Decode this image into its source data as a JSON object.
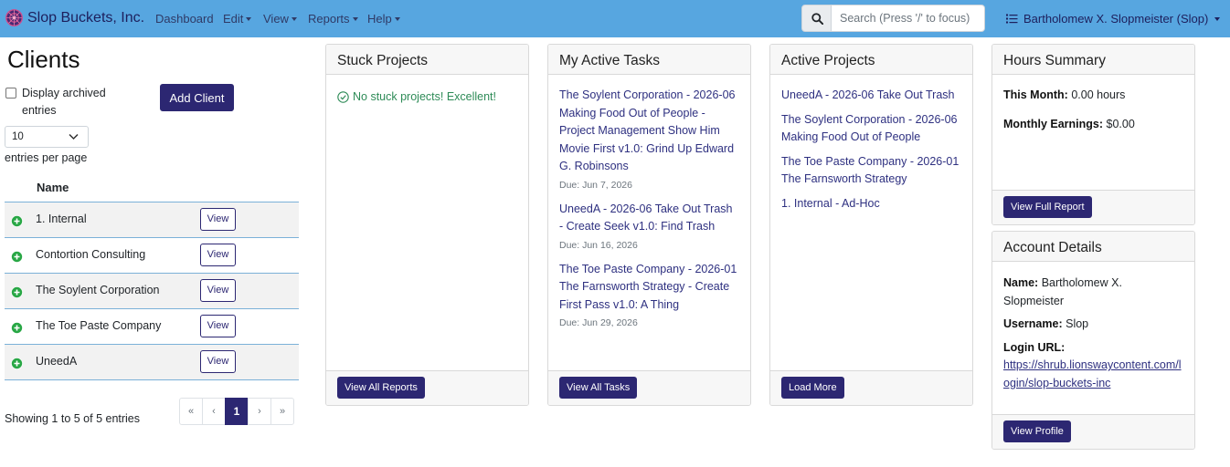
{
  "navbar": {
    "brand": "Slop Buckets, Inc.",
    "menu": {
      "dashboard": "Dashboard",
      "edit": "Edit",
      "view": "View",
      "reports": "Reports",
      "help": "Help"
    },
    "search": {
      "placeholder": "Search (Press '/' to focus)",
      "value": ""
    },
    "user": "Bartholomew X. Slopmeister (Slop)",
    "color": "#57a6e0"
  },
  "clients": {
    "title": "Clients",
    "archived_label": "Display archived entries",
    "add_button": "Add Client",
    "per_page_value": "10",
    "per_page_label": "entries per page",
    "column_name": "Name",
    "view_label": "View",
    "rows": [
      {
        "name": "1. Internal"
      },
      {
        "name": "Contortion Consulting"
      },
      {
        "name": "The Soylent Corporation"
      },
      {
        "name": "The Toe Paste Company"
      },
      {
        "name": "UneedA"
      }
    ],
    "showing": "Showing 1 to 5 of 5 entries",
    "pager": {
      "first": "«",
      "prev": "‹",
      "current": "1",
      "next": "›",
      "last": "»"
    }
  },
  "stuck_projects": {
    "title": "Stuck Projects",
    "message": "No stuck projects! Excellent!",
    "footer_button": "View All Reports"
  },
  "active_tasks": {
    "title": "My Active Tasks",
    "tasks": [
      {
        "text": "The Soylent Corporation - 2026-06 Making Food Out of People - Project Management Show Him Movie First v1.0: Grind Up Edward G. Robinsons",
        "due": "Due: Jun 7, 2026"
      },
      {
        "text": "UneedA - 2026-06 Take Out Trash - Create Seek v1.0: Find Trash",
        "due": "Due: Jun 16, 2026"
      },
      {
        "text": "The Toe Paste Company - 2026-01 The Farnsworth Strategy - Create First Pass v1.0: A Thing",
        "due": "Due: Jun 29, 2026"
      }
    ],
    "footer_button": "View All Tasks"
  },
  "active_projects": {
    "title": "Active Projects",
    "projects": [
      "UneedA - 2026-06 Take Out Trash",
      "The Soylent Corporation - 2026-06 Making Food Out of People",
      "The Toe Paste Company - 2026-01 The Farnsworth Strategy",
      "1. Internal - Ad-Hoc"
    ],
    "footer_button": "Load More"
  },
  "hours_summary": {
    "title": "Hours Summary",
    "this_month_label": "This Month:",
    "this_month_value": "0.00 hours",
    "earnings_label": "Monthly Earnings:",
    "earnings_value": "$0.00",
    "footer_button": "View Full Report"
  },
  "account_details": {
    "title": "Account Details",
    "name_label": "Name:",
    "name_value": "Bartholomew X. Slopmeister",
    "username_label": "Username:",
    "username_value": "Slop",
    "login_url_label": "Login URL:",
    "login_url_value": "https://shrub.lionswaycontent.com/login/slop-buckets-inc",
    "footer_button": "View Profile"
  },
  "icons": {
    "brand": "brand-logo-icon",
    "search": "search-icon",
    "user_menu": "list-icon",
    "row": "plus-circle-icon",
    "success": "check-circle-icon"
  },
  "colors": {
    "primary": "#2c2772",
    "link": "#2e3080",
    "success": "#2e8b57",
    "row_icon": "#28a745"
  }
}
